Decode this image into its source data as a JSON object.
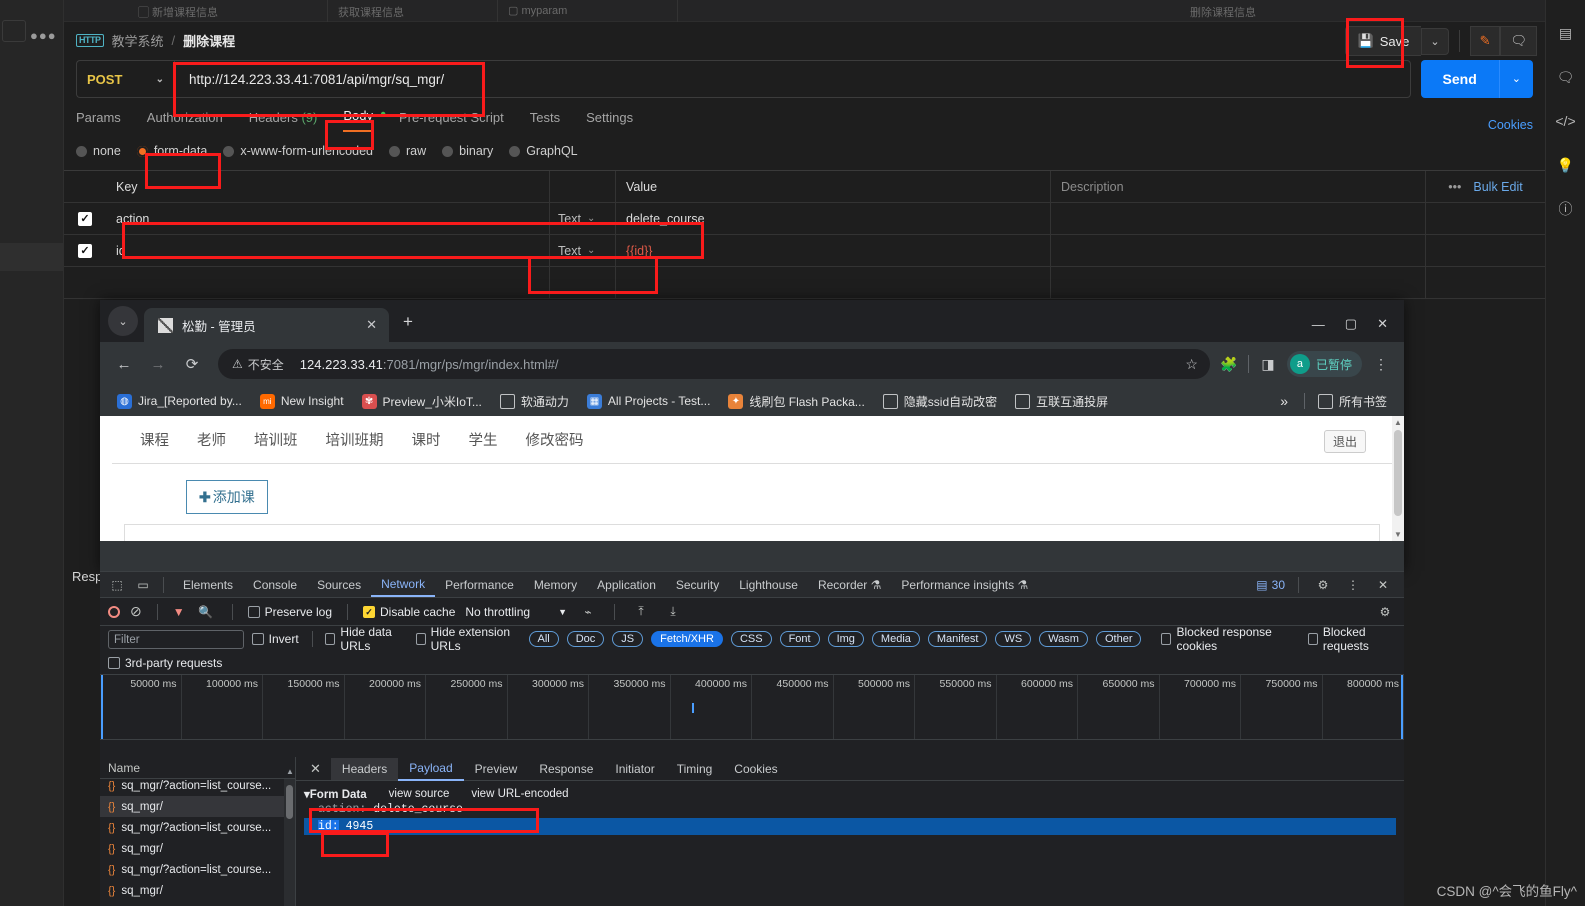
{
  "postman": {
    "breadcrumb": {
      "icon": "HTTP",
      "parent": "教学系统",
      "sep": "/",
      "current": "删除课程"
    },
    "save_label": "Save",
    "method": "POST",
    "url": "http://124.223.33.41:7081/api/mgr/sq_mgr/",
    "send_label": "Send",
    "cookies_label": "Cookies",
    "tabs": [
      {
        "label": "Params"
      },
      {
        "label": "Authorization"
      },
      {
        "label": "Headers",
        "count": "(9)"
      },
      {
        "label": "Body",
        "active": true,
        "dot": "•"
      },
      {
        "label": "Pre-request Script"
      },
      {
        "label": "Tests"
      },
      {
        "label": "Settings"
      }
    ],
    "body_types": [
      {
        "label": "none",
        "selected": false
      },
      {
        "label": "form-data",
        "selected": true
      },
      {
        "label": "x-www-form-urlencoded",
        "selected": false
      },
      {
        "label": "raw",
        "selected": false
      },
      {
        "label": "binary",
        "selected": false
      },
      {
        "label": "GraphQL",
        "selected": false
      }
    ],
    "table": {
      "headers": {
        "key": "Key",
        "value": "Value",
        "description": "Description",
        "bulk": "Bulk Edit",
        "dots": "•••"
      },
      "rows": [
        {
          "checked": "✓",
          "key": "action",
          "type": "Text",
          "value": "delete_course",
          "description": ""
        },
        {
          "checked": "✓",
          "key": "id",
          "type": "Text",
          "value": "{{id}}",
          "description": "",
          "is_var": true
        }
      ]
    },
    "response_label": "Resp"
  },
  "browser": {
    "tab_title": "松勤 - 管理员",
    "tab_close": "✕",
    "new_tab": "+",
    "security_label": "不安全",
    "url_host": "124.223.33.41",
    "url_path": ":7081/mgr/ps/mgr/index.html#/",
    "profile_text": "已暂停",
    "profile_letter": "a",
    "bookmarks": [
      {
        "label": "Jira_[Reported by...",
        "icon_color": "#2a6fd6",
        "glyph": "◍"
      },
      {
        "label": "New Insight",
        "icon_color": "#ff6900",
        "glyph": "mi"
      },
      {
        "label": "Preview_小米IoT...",
        "icon_color": "#d94f4f",
        "glyph": "✾"
      },
      {
        "label": "软通动力",
        "icon_color": "#6b6b6b",
        "glyph": "▢"
      },
      {
        "label": "All Projects - Test...",
        "icon_color": "#3b7dd8",
        "glyph": "▦"
      },
      {
        "label": "线刷包 Flash Packa...",
        "icon_color": "#e8833a",
        "glyph": "✦"
      },
      {
        "label": "隐藏ssid自动改密",
        "icon_color": "#6b6b6b",
        "glyph": "▢"
      },
      {
        "label": "互联互通投屏",
        "icon_color": "#6b6b6b",
        "glyph": "▢"
      }
    ],
    "bookmarks_overflow": "»",
    "all_bookmarks": "所有书签",
    "page": {
      "nav": [
        "课程",
        "老师",
        "培训班",
        "培训班期",
        "课时",
        "学生",
        "修改密码"
      ],
      "logout": "退出",
      "add_button": "添加课"
    }
  },
  "devtools": {
    "panels": [
      {
        "label": "Elements"
      },
      {
        "label": "Console"
      },
      {
        "label": "Sources"
      },
      {
        "label": "Network",
        "active": true
      },
      {
        "label": "Performance"
      },
      {
        "label": "Memory"
      },
      {
        "label": "Application"
      },
      {
        "label": "Security"
      },
      {
        "label": "Lighthouse"
      },
      {
        "label": "Recorder ⚗"
      },
      {
        "label": "Performance insights ⚗"
      }
    ],
    "issues_count": "30",
    "toolbar": {
      "preserve_log": "Preserve log",
      "disable_cache": "Disable cache",
      "disable_cache_on": "✓",
      "throttling": "No throttling"
    },
    "filter_placeholder": "Filter",
    "filter_row": {
      "invert": "Invert",
      "hide_data_urls": "Hide data URLs",
      "hide_ext_urls": "Hide extension URLs",
      "blocked_cookies": "Blocked response cookies",
      "blocked_requests": "Blocked requests",
      "third_party": "3rd-party requests"
    },
    "resource_chips": [
      {
        "label": "All",
        "on": false
      },
      {
        "label": "Doc",
        "on": false
      },
      {
        "label": "JS",
        "on": false
      },
      {
        "label": "Fetch/XHR",
        "on": true
      },
      {
        "label": "CSS",
        "on": false
      },
      {
        "label": "Font",
        "on": false
      },
      {
        "label": "Img",
        "on": false
      },
      {
        "label": "Media",
        "on": false
      },
      {
        "label": "Manifest",
        "on": false
      },
      {
        "label": "WS",
        "on": false
      },
      {
        "label": "Wasm",
        "on": false
      },
      {
        "label": "Other",
        "on": false
      }
    ],
    "timeline_ticks": [
      "50000 ms",
      "100000 ms",
      "150000 ms",
      "200000 ms",
      "250000 ms",
      "300000 ms",
      "350000 ms",
      "400000 ms",
      "450000 ms",
      "500000 ms",
      "550000 ms",
      "600000 ms",
      "650000 ms",
      "700000 ms",
      "750000 ms",
      "800000 ms"
    ],
    "name_header": "Name",
    "requests": [
      {
        "name": "sq_mgr/?action=list_course...",
        "selected": false
      },
      {
        "name": "sq_mgr/",
        "selected": true
      },
      {
        "name": "sq_mgr/?action=list_course...",
        "selected": false
      },
      {
        "name": "sq_mgr/",
        "selected": false
      },
      {
        "name": "sq_mgr/?action=list_course...",
        "selected": false
      },
      {
        "name": "sq_mgr/",
        "selected": false
      }
    ],
    "detail_tabs": [
      {
        "label": "Headers"
      },
      {
        "label": "Payload",
        "active": true
      },
      {
        "label": "Preview"
      },
      {
        "label": "Response"
      },
      {
        "label": "Initiator"
      },
      {
        "label": "Timing"
      },
      {
        "label": "Cookies"
      }
    ],
    "detail_close": "✕",
    "form_data": {
      "title": "Form Data",
      "view_source": "view source",
      "view_url_encoded": "view URL-encoded",
      "entries": [
        {
          "key": "action:",
          "value": "delete_course",
          "selected": false
        },
        {
          "key": "id:",
          "value": "4945",
          "selected": true
        }
      ]
    }
  },
  "watermark": "CSDN @^会飞的鱼Fly^"
}
